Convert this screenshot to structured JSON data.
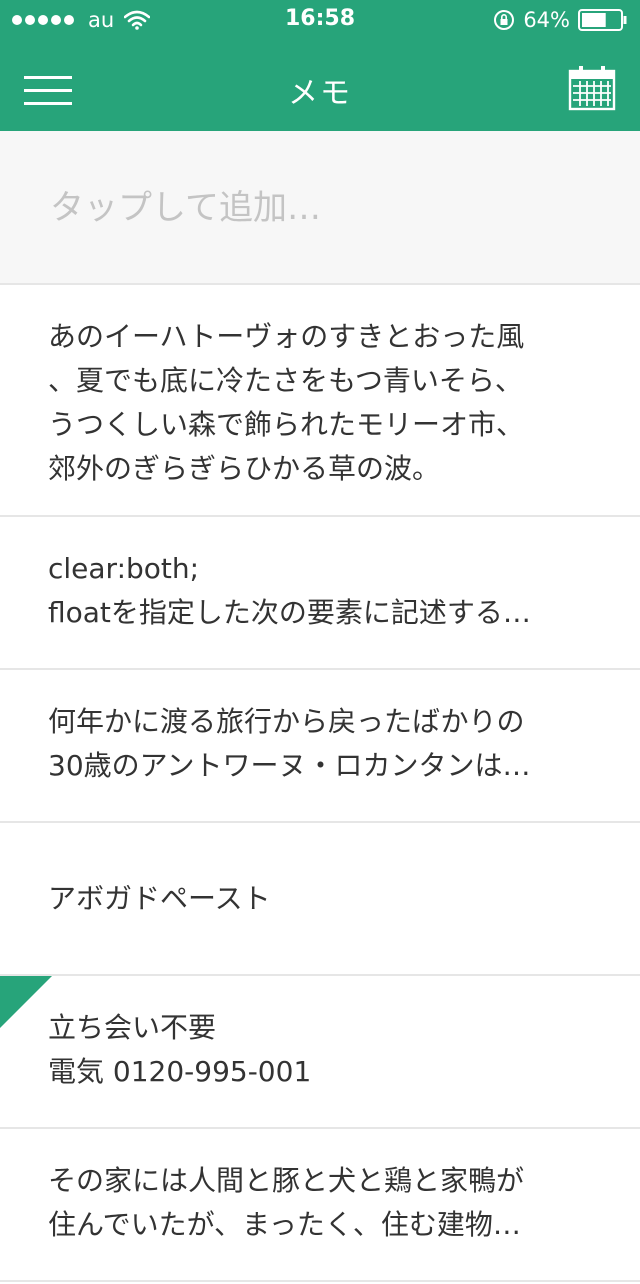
{
  "status_bar": {
    "carrier": "au",
    "time": "16:58",
    "battery_percent": "64%",
    "battery_level": 0.64
  },
  "nav": {
    "title": "メモ",
    "menu_icon": "hamburger-menu-icon",
    "calendar_icon": "calendar-icon"
  },
  "add_field": {
    "placeholder": "タップして追加…"
  },
  "memos": [
    {
      "text": "あのイーハトーヴォのすきとおった風\n、夏でも底に冷たさをもつ青いそら、\nうつくしい森で飾られたモリーオ市、\n郊外のぎらぎらひかる草の波。"
    },
    {
      "text": "clear:both;\nfloatを指定した次の要素に記述する…"
    },
    {
      "text": "何年かに渡る旅行から戻ったばかりの\n30歳のアントワーヌ・ロカンタンは…"
    },
    {
      "text": "アボガドペースト"
    },
    {
      "text": "立ち会い不要\n電気 0120-995-001",
      "flagged": true
    },
    {
      "text": "その家には人間と豚と犬と鶏と家鴨が\n住んでいたが、まったく、住む建物…"
    }
  ],
  "colors": {
    "accent": "#27a47a",
    "text": "#333333",
    "placeholder": "#c4c4c4",
    "divider": "#e6e6e6"
  }
}
